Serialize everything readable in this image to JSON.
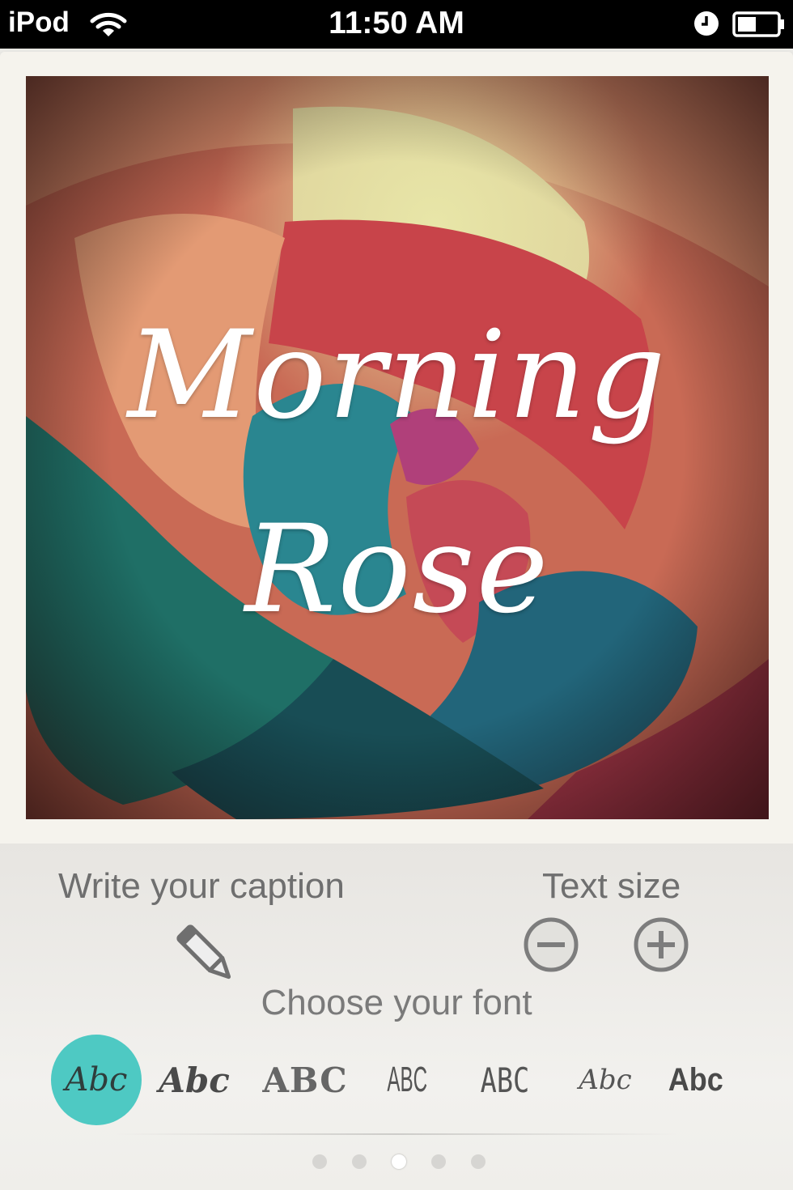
{
  "status_bar": {
    "carrier": "iPod",
    "time": "11:50 AM"
  },
  "photo": {
    "caption_line1": "Morning",
    "caption_line2": "Rose"
  },
  "controls": {
    "write_caption_label": "Write your caption",
    "text_size_label": "Text size",
    "choose_font_label": "Choose your font",
    "accent_color": "#4ec9c3",
    "fonts": [
      {
        "label": "Abc",
        "selected": true
      },
      {
        "label": "Abc",
        "selected": false
      },
      {
        "label": "ABC",
        "selected": false
      },
      {
        "label": "ABC",
        "selected": false
      },
      {
        "label": "ABC",
        "selected": false
      },
      {
        "label": "Abc",
        "selected": false
      },
      {
        "label": "Abc",
        "selected": false
      }
    ],
    "page_count": 5,
    "active_page": 3
  },
  "icons": {
    "edit": "pencil-icon",
    "decrease": "minus-circle-icon",
    "increase": "plus-circle-icon"
  }
}
